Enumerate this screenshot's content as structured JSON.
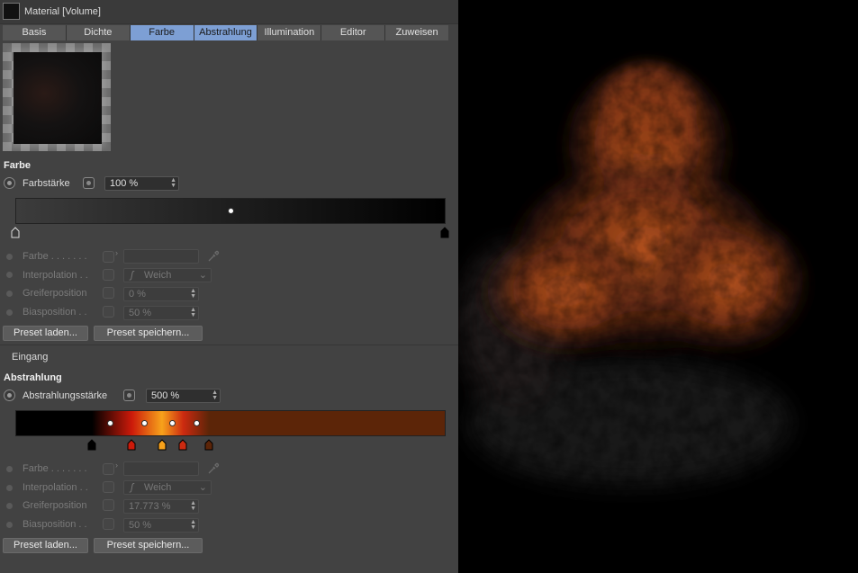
{
  "window": {
    "title": "Material [Volume]"
  },
  "tabs": [
    {
      "label": "Basis",
      "active": false
    },
    {
      "label": "Dichte",
      "active": false
    },
    {
      "label": "Farbe",
      "active": true
    },
    {
      "label": "Abstrahlung",
      "active": true
    },
    {
      "label": "Illumination",
      "active": false
    },
    {
      "label": "Editor",
      "active": false
    },
    {
      "label": "Zuweisen",
      "active": false
    }
  ],
  "farbe": {
    "section_title": "Farbe",
    "strength_label": "Farbstärke",
    "strength_value": "100 %",
    "gradient": {
      "stops": [
        {
          "color": "#3c3c3c",
          "position": 0
        },
        {
          "color": "#000000",
          "position": 1
        }
      ],
      "knob_position": 0.5
    },
    "props": {
      "color_label": "Farbe . . . . . . .",
      "interpolation_label": "Interpolation . .",
      "interpolation_value": "Weich",
      "knob_label": "Greiferposition",
      "knob_value": "0 %",
      "bias_label": "Biasposition . .",
      "bias_value": "50 %"
    },
    "preset_load": "Preset laden...",
    "preset_save": "Preset speichern..."
  },
  "eingang_label": "Eingang",
  "abstrahlung": {
    "section_title": "Abstrahlung",
    "strength_label": "Abstrahlungsstärke",
    "strength_value": "500 %",
    "gradient": {
      "stops": [
        {
          "color": "#000000",
          "position": 0.177
        },
        {
          "color": "#cc1a0a",
          "position": 0.27
        },
        {
          "color": "#f7a21b",
          "position": 0.34
        },
        {
          "color": "#cc2a10",
          "position": 0.39
        },
        {
          "color": "#5c2508",
          "position": 0.45
        }
      ],
      "knob_positions": [
        0.22,
        0.3,
        0.365,
        0.42
      ]
    },
    "props": {
      "color_label": "Farbe . . . . . . .",
      "interpolation_label": "Interpolation . .",
      "interpolation_value": "Weich",
      "knob_label": "Greiferposition",
      "knob_value": "17.773 %",
      "bias_label": "Biasposition . .",
      "bias_value": "50 %"
    },
    "preset_load": "Preset laden...",
    "preset_save": "Preset speichern..."
  }
}
